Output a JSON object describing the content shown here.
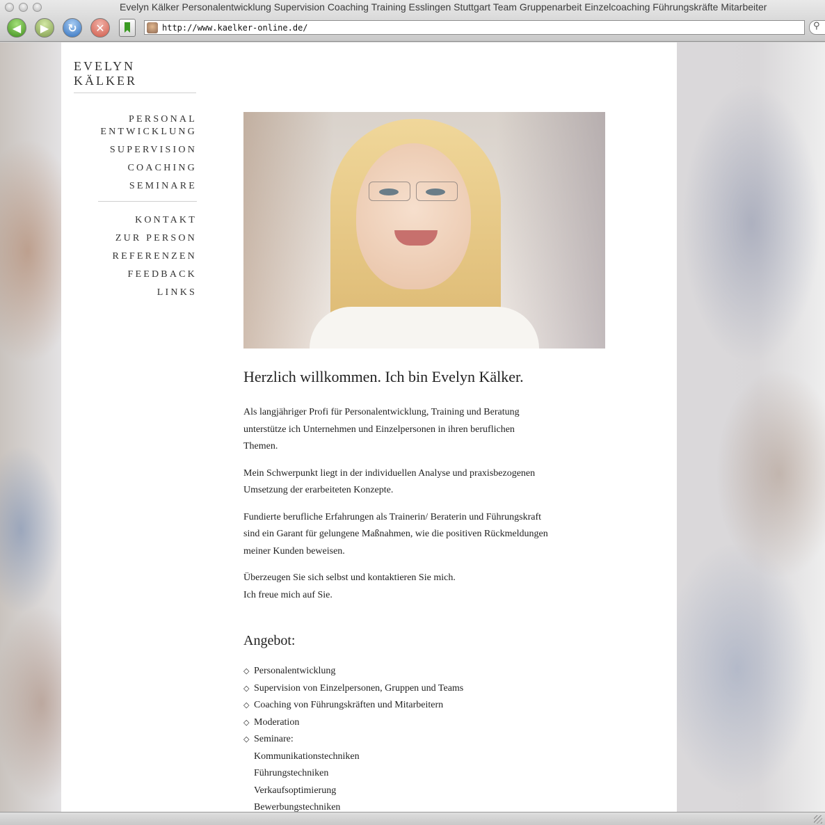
{
  "window": {
    "title": "Evelyn Kälker Personalentwicklung Supervision Coaching Training Esslingen Stuttgart Team Gruppenarbeit Einzelcoaching Führungskräfte Mitarbeiter",
    "url": "http://www.kaelker-online.de/"
  },
  "site": {
    "brand": "EVELYN KÄLKER"
  },
  "nav": {
    "primary": [
      {
        "label": "PERSONAL ENTWICKLUNG"
      },
      {
        "label": "SUPERVISION"
      },
      {
        "label": "COACHING"
      },
      {
        "label": "SEMINARE"
      }
    ],
    "secondary": [
      {
        "label": "KONTAKT"
      },
      {
        "label": "ZUR PERSON"
      },
      {
        "label": "REFERENZEN"
      },
      {
        "label": "FEEDBACK"
      },
      {
        "label": "LINKS"
      }
    ]
  },
  "main": {
    "heading": "Herzlich willkommen. Ich bin Evelyn Kälker.",
    "paragraphs": [
      "Als langjähriger Profi für Personalentwicklung, Training und Beratung unterstütze ich Unternehmen und Einzelpersonen in ihren beruflichen Themen.",
      "Mein Schwerpunkt liegt in der individuellen Analyse und praxisbezogenen Umsetzung der erarbeiteten Konzepte.",
      "Fundierte berufliche Erfahrungen als Trainerin/ Beraterin und Führungskraft sind ein Garant für gelungene Maßnahmen, wie die positiven Rückmeldungen meiner Kunden beweisen.",
      "Überzeugen Sie sich selbst und kontaktieren Sie mich.",
      "Ich freue mich auf Sie."
    ],
    "offer_heading": "Angebot:",
    "offers": [
      "Personalentwicklung",
      "Supervision von Einzelpersonen, Gruppen und Teams",
      "Coaching von Führungskräften und Mitarbeitern",
      "Moderation",
      "Seminare:"
    ],
    "seminars": [
      "Kommunikationstechniken",
      "Führungstechniken",
      "Verkaufsoptimierung",
      "Bewerbungstechniken"
    ]
  }
}
